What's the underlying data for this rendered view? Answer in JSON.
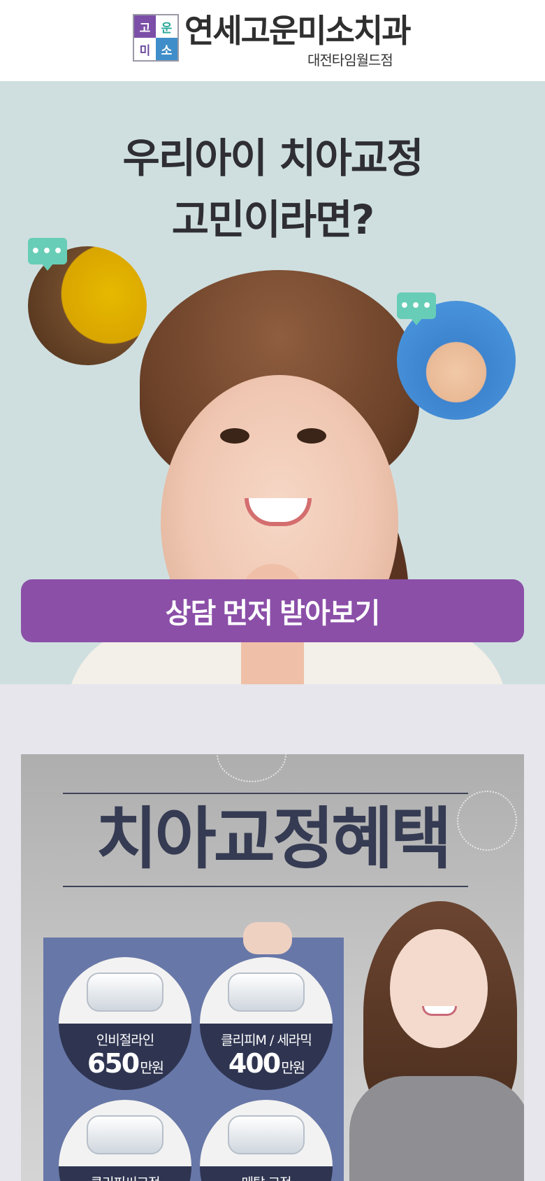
{
  "header": {
    "logo_cells": [
      "고",
      "운",
      "미",
      "소"
    ],
    "brand_name": "연세고운미소치과",
    "branch_name": "대전타임월드점"
  },
  "hero": {
    "title_line1": "우리아이 치아교정",
    "title_line2": "고민이라면?",
    "bubble_icon": "chat-bubble-icon",
    "cta_label": "상담 먼저 받아보기"
  },
  "promo": {
    "title": "치아교정혜택",
    "items": [
      {
        "name": "인비절라인",
        "price": "650",
        "unit": "만원"
      },
      {
        "name": "클리피M / 세라믹",
        "price": "400",
        "unit": "만원"
      },
      {
        "name": "클리피씨교정",
        "price": "",
        "unit": ""
      },
      {
        "name": "메탈 교정",
        "price": "",
        "unit": ""
      }
    ]
  },
  "colors": {
    "accent": "#8b4fa8",
    "hero_bg": "#cfdfe0",
    "page_bg": "#e6e6ec",
    "board": "#6777a8",
    "circle": "#2f3551"
  }
}
